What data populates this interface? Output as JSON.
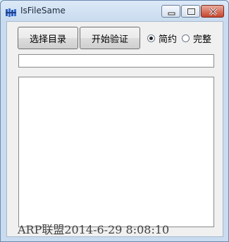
{
  "window": {
    "title": "IsFileSame",
    "controls": {
      "minimize_icon": "minimize-icon",
      "maximize_icon": "maximize-icon",
      "close_icon": "close-icon"
    }
  },
  "toolbar": {
    "select_dir_label": "选择目录",
    "start_verify_label": "开始验证"
  },
  "mode": {
    "options": [
      {
        "label": "简约",
        "selected": true
      },
      {
        "label": "完整",
        "selected": false
      }
    ]
  },
  "path_field": {
    "value": ""
  },
  "output": {
    "text": ""
  },
  "watermark": "ARP联盟2014-6-29 8:08:10",
  "colors": {
    "close_button": "#c6452d",
    "client_bg": "#f0f0f0",
    "frame": "#c9dbef"
  }
}
